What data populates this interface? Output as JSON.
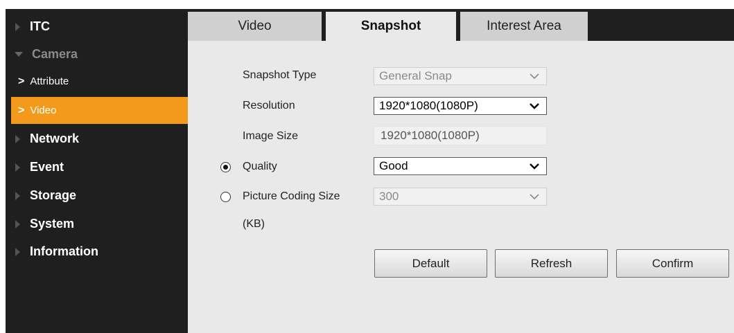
{
  "sidebar": {
    "items": [
      {
        "label": "ITC"
      },
      {
        "label": "Camera"
      },
      {
        "label": "Attribute"
      },
      {
        "label": "Video"
      },
      {
        "label": "Network"
      },
      {
        "label": "Event"
      },
      {
        "label": "Storage"
      },
      {
        "label": "System"
      },
      {
        "label": "Information"
      }
    ]
  },
  "tabs": [
    {
      "label": "Video"
    },
    {
      "label": "Snapshot"
    },
    {
      "label": "Interest Area"
    }
  ],
  "form": {
    "snapshot_type": {
      "label": "Snapshot Type",
      "value": "General Snap"
    },
    "resolution": {
      "label": "Resolution",
      "value": "1920*1080(1080P)"
    },
    "image_size": {
      "label": "Image Size",
      "value": "1920*1080(1080P)"
    },
    "quality": {
      "label": "Quality",
      "value": "Good",
      "selected": true
    },
    "picture_coding_size": {
      "label": "Picture Coding Size",
      "label_unit": "(KB)",
      "value": "300",
      "selected": false
    }
  },
  "buttons": {
    "default": "Default",
    "refresh": "Refresh",
    "confirm": "Confirm"
  },
  "colors": {
    "accent": "#f39a1c",
    "sidebar_bg": "#1f1f1f",
    "content_bg": "#e9e9e9"
  }
}
